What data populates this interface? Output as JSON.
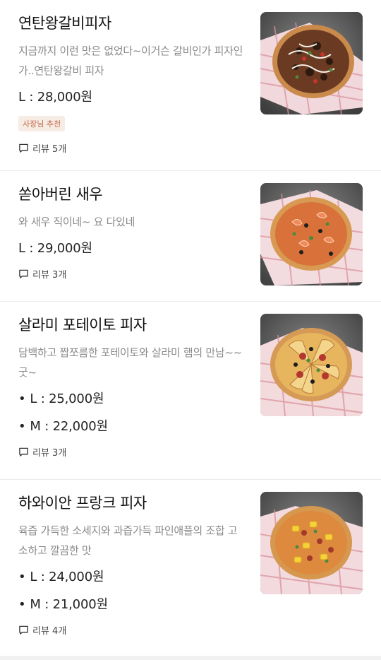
{
  "menu": {
    "items": [
      {
        "title": "연탄왕갈비피자",
        "description": "지금까지 이런 맛은 없었다~이거슨 갈비인가 피자인가..연탄왕갈비 피자",
        "prices": [
          "L : 28,000원"
        ],
        "badge": "사장님 추천",
        "review": "리뷰 5개",
        "image_icon": "pizza-bulgogi-photo"
      },
      {
        "title": "쏟아버린 새우",
        "description": "와 새우 직이네~ 요 다있네",
        "prices": [
          "L : 29,000원"
        ],
        "review": "리뷰 3개",
        "image_icon": "pizza-shrimp-photo"
      },
      {
        "title": "살라미 포테이토 피자",
        "description": "담백하고 짭쪼름한 포테이토와 살라미 햄의 만남~~굿~",
        "prices": [
          "L : 25,000원",
          "M : 22,000원"
        ],
        "review": "리뷰 3개",
        "image_icon": "pizza-potato-photo"
      },
      {
        "title": "하와이안 프랑크 피자",
        "description": "육즙 가득한 소세지와 과즙가득 파인애플의 조합 고소하고 깔끔한 맛",
        "prices": [
          "L : 24,000원",
          "M : 21,000원"
        ],
        "review": "리뷰 4개",
        "image_icon": "pizza-hawaiian-photo"
      }
    ],
    "bullet": "•"
  },
  "colors": {
    "badge_text": "#c0694a",
    "badge_bg": "#f7ece4",
    "description": "#8a8a8a",
    "divider": "#ececec"
  }
}
